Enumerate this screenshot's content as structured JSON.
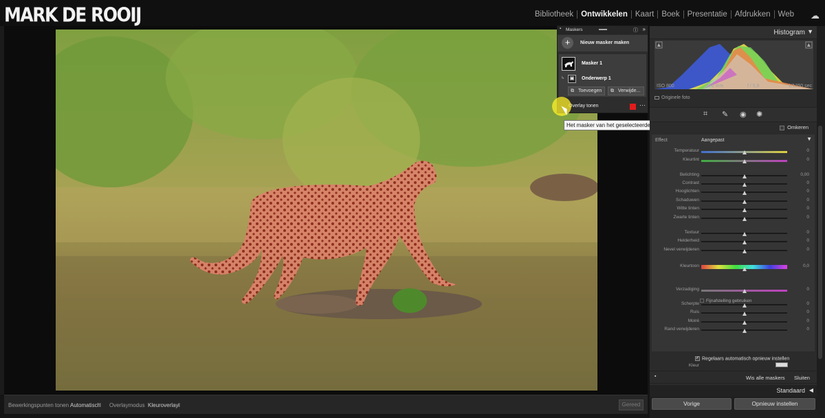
{
  "brand": {
    "logo": "MARK DE ROOIJ"
  },
  "modules": [
    "Bibliotheek",
    "Ontwikkelen",
    "Kaart",
    "Boek",
    "Presentatie",
    "Afdrukken",
    "Web"
  ],
  "active_module": "Ontwikkelen",
  "toolbar": {
    "edit_points_label": "Bewerkingspunten tonen",
    "edit_points_value": "Automatisch",
    "overlay_mode_label": "Overlaymodus",
    "overlay_mode_value": "Kleuroverlay",
    "done_button": "Gereed"
  },
  "masks_panel": {
    "title": "Maskers",
    "new_mask": "Nieuw masker maken",
    "mask_name": "Masker 1",
    "component_name": "Onderwerp 1",
    "add_button": "Toevoegen",
    "remove_button": "Verwijde...",
    "overlay_label": "Overlay tonen",
    "overlay_color": "#e21c1c"
  },
  "tooltip": "Het masker van het geselecteerde punt (O) tonen of verbergen",
  "histogram": {
    "title": "Histogram",
    "iso": "ISO 800",
    "focal": "370 mm",
    "aperture": "f / 5,6",
    "shutter": "1/1250 sec",
    "original_photo": "Originele foto"
  },
  "mask_settings": {
    "invert_label": "Omkeren",
    "effect_label": "Effect",
    "effect_value": "Aangepast",
    "sliders": [
      {
        "label": "Temperatuur",
        "value": "0",
        "level": 0.5
      },
      {
        "label": "Kleurtint",
        "value": "0",
        "level": 0.5
      },
      {
        "label": "Belichting",
        "value": "0,00",
        "level": 0.5
      },
      {
        "label": "Contrast",
        "value": "0",
        "level": 0.5
      },
      {
        "label": "Hooglichten",
        "value": "0",
        "level": 0.5
      },
      {
        "label": "Schaduwen",
        "value": "0",
        "level": 0.5
      },
      {
        "label": "Witte tinten",
        "value": "0",
        "level": 0.5
      },
      {
        "label": "Zwarte tinten",
        "value": "0",
        "level": 0.5
      },
      {
        "label": "Textuur",
        "value": "0",
        "level": 0.5
      },
      {
        "label": "Helderheid",
        "value": "0",
        "level": 0.5
      },
      {
        "label": "Nevel verwijderen",
        "value": "0",
        "level": 0.5
      },
      {
        "label": "Kleurtoon",
        "value": "0,0",
        "level": 0.5
      },
      {
        "label": "Verzadiging",
        "value": "0",
        "level": 0.5
      },
      {
        "label": "Scherpte",
        "value": "0",
        "level": 0.5
      },
      {
        "label": "Ruis",
        "value": "0",
        "level": 0.5
      },
      {
        "label": "Moiré",
        "value": "0",
        "level": 0.5
      },
      {
        "label": "Rand verwijderen",
        "value": "0",
        "level": 0.5
      }
    ],
    "fine_tune": "Fijnafstelling gebruiken",
    "color_label": "Kleur",
    "auto_reset": "Regelaars automatisch opnieuw instellen",
    "clear_all": "Wis alle maskers",
    "close": "Sluiten"
  },
  "preset_panel": "Standaard",
  "buttons": {
    "previous": "Vorige",
    "reset": "Opnieuw instellen"
  }
}
